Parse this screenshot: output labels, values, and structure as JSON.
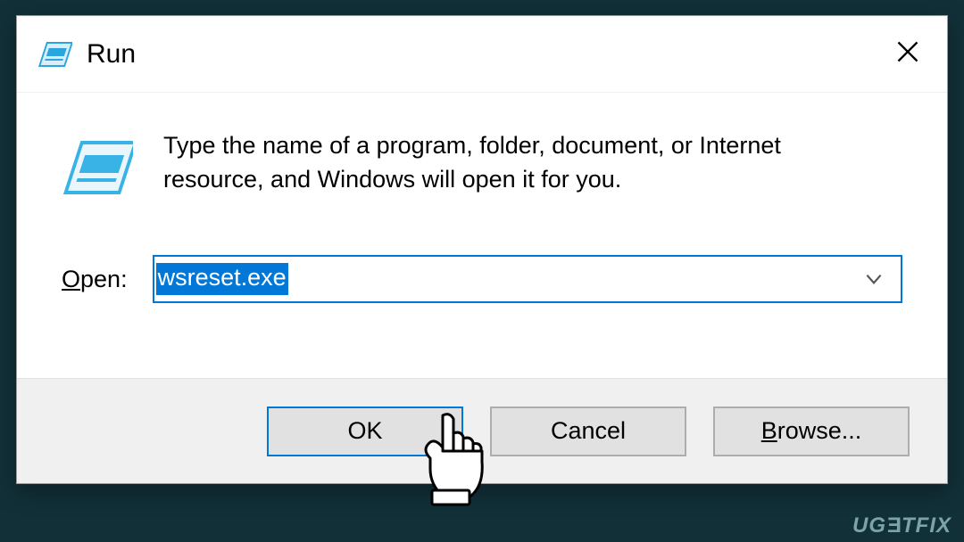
{
  "dialog": {
    "title": "Run",
    "instruction": "Type the name of a program, folder, document, or Internet resource, and Windows will open it for you.",
    "open": {
      "label_pre": "O",
      "label_post": "pen:",
      "value": "wsreset.exe"
    },
    "buttons": {
      "ok": "OK",
      "cancel": "Cancel",
      "browse_pre": "B",
      "browse_post": "rowse..."
    }
  },
  "watermark": {
    "pre": "UG",
    "e": "E",
    "post": "TFIX"
  }
}
